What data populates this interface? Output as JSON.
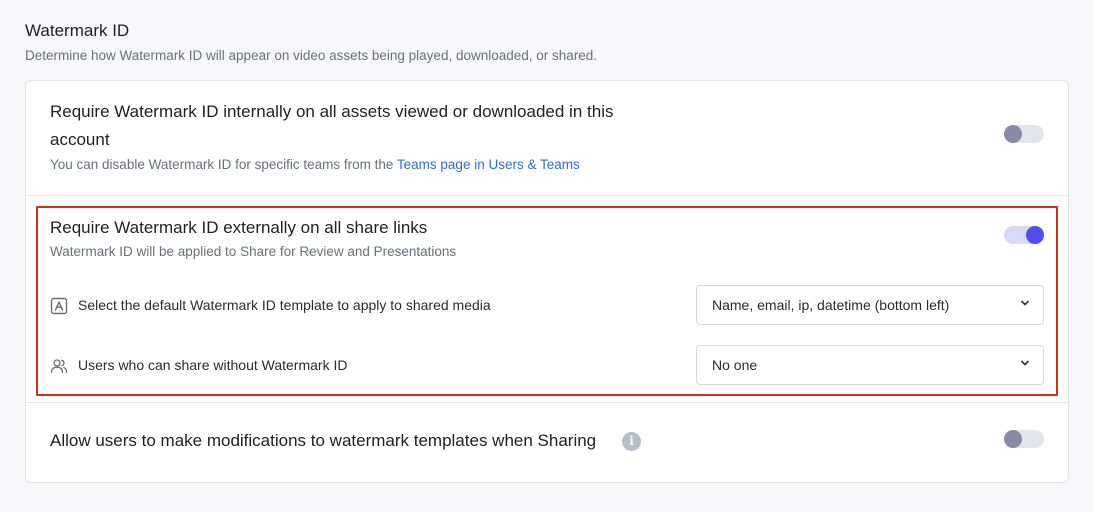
{
  "header": {
    "title": "Watermark ID",
    "description": "Determine how Watermark ID will appear on video assets being played, downloaded, or shared."
  },
  "internal": {
    "title": "Require Watermark ID internally on all assets viewed or downloaded in this account",
    "subtitle_prefix": "You can disable Watermark ID for specific teams from the ",
    "subtitle_link": "Teams page in Users & Teams",
    "toggle_state": "off"
  },
  "external": {
    "title": "Require Watermark ID externally on all share links",
    "subtitle": "Watermark ID will be applied to Share for Review and Presentations",
    "toggle_state": "on",
    "template_setting": {
      "label": "Select the default Watermark ID template to apply to shared media",
      "icon": "text-template-icon",
      "selected": "Name, email, ip, datetime (bottom left)"
    },
    "users_setting": {
      "label": "Users who can share without Watermark ID",
      "icon": "users-icon",
      "selected": "No one"
    }
  },
  "modifications": {
    "title": "Allow users to make modifications to watermark templates when Sharing",
    "info_glyph": "i",
    "toggle_state": "off"
  },
  "colors": {
    "accent": "#4f4ff0",
    "highlight_border": "#d0301a",
    "link": "#2c6fd6"
  }
}
